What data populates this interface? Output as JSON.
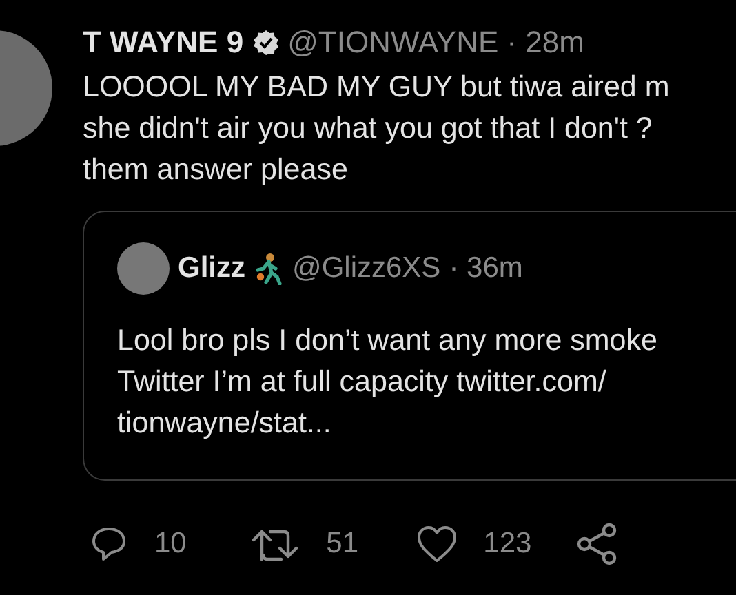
{
  "tweet": {
    "author": {
      "name": "T WAYNE 9",
      "verified": true,
      "handle": "@TIONWAYNE",
      "time": "· 28m"
    },
    "body_lines": [
      "LOOOOL MY BAD MY GUY but tiwa aired m",
      "she didn't air you what you got that I don't ?",
      "them answer please"
    ],
    "quoted": {
      "name": "Glizz",
      "handle": "@Glizz6XS",
      "time": "· 36m",
      "body_lines": [
        "Lool bro pls I don’t want any more smoke",
        "Twitter I’m at full capacity twitter.com/",
        "tionwayne/stat..."
      ]
    },
    "actions": [
      {
        "kind": "reply",
        "count": "10"
      },
      {
        "kind": "retweet",
        "count": "51"
      },
      {
        "kind": "like",
        "count": "123"
      },
      {
        "kind": "share"
      }
    ]
  }
}
